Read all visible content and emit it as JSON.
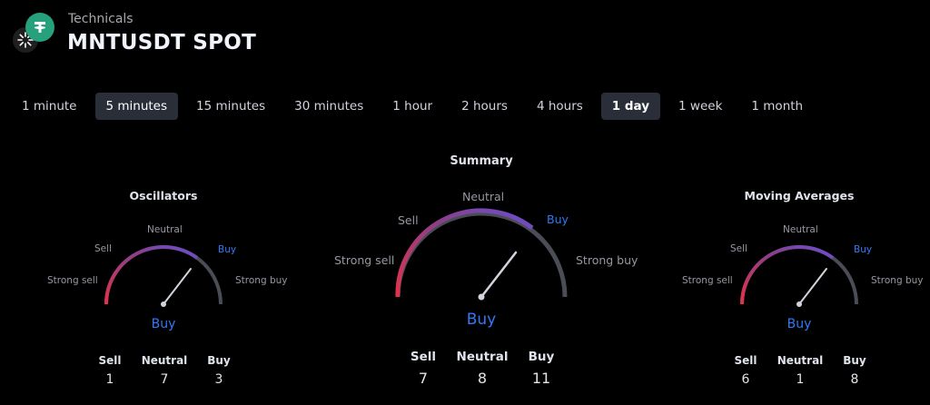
{
  "header": {
    "eyebrow": "Technicals",
    "symbol": "MNTUSDT SPOT"
  },
  "tabs": [
    {
      "label": "1 minute",
      "active": false
    },
    {
      "label": "5 minutes",
      "active": true
    },
    {
      "label": "15 minutes",
      "active": false
    },
    {
      "label": "30 minutes",
      "active": false
    },
    {
      "label": "1 hour",
      "active": false
    },
    {
      "label": "2 hours",
      "active": false
    },
    {
      "label": "4 hours",
      "active": false
    },
    {
      "label": "1 day",
      "active": true
    },
    {
      "label": "1 week",
      "active": false
    },
    {
      "label": "1 month",
      "active": false
    }
  ],
  "gauge_labels": {
    "strong_sell": "Strong sell",
    "sell": "Sell",
    "neutral": "Neutral",
    "buy": "Buy",
    "strong_buy": "Strong buy"
  },
  "count_labels": {
    "sell": "Sell",
    "neutral": "Neutral",
    "buy": "Buy"
  },
  "colors": {
    "sell": "#e2324d",
    "neutral_mid": "#8a3f8a",
    "buy": "#3179f5",
    "track": "#4a4d55",
    "needle": "#d1d4dc"
  },
  "oscillators": {
    "title": "Oscillators",
    "reading": "Buy",
    "sell": "1",
    "neutral": "7",
    "buy": "3"
  },
  "summary": {
    "title": "Summary",
    "reading": "Buy",
    "sell": "7",
    "neutral": "8",
    "buy": "11"
  },
  "moving_averages": {
    "title": "Moving Averages",
    "reading": "Buy",
    "sell": "6",
    "neutral": "1",
    "buy": "8"
  }
}
